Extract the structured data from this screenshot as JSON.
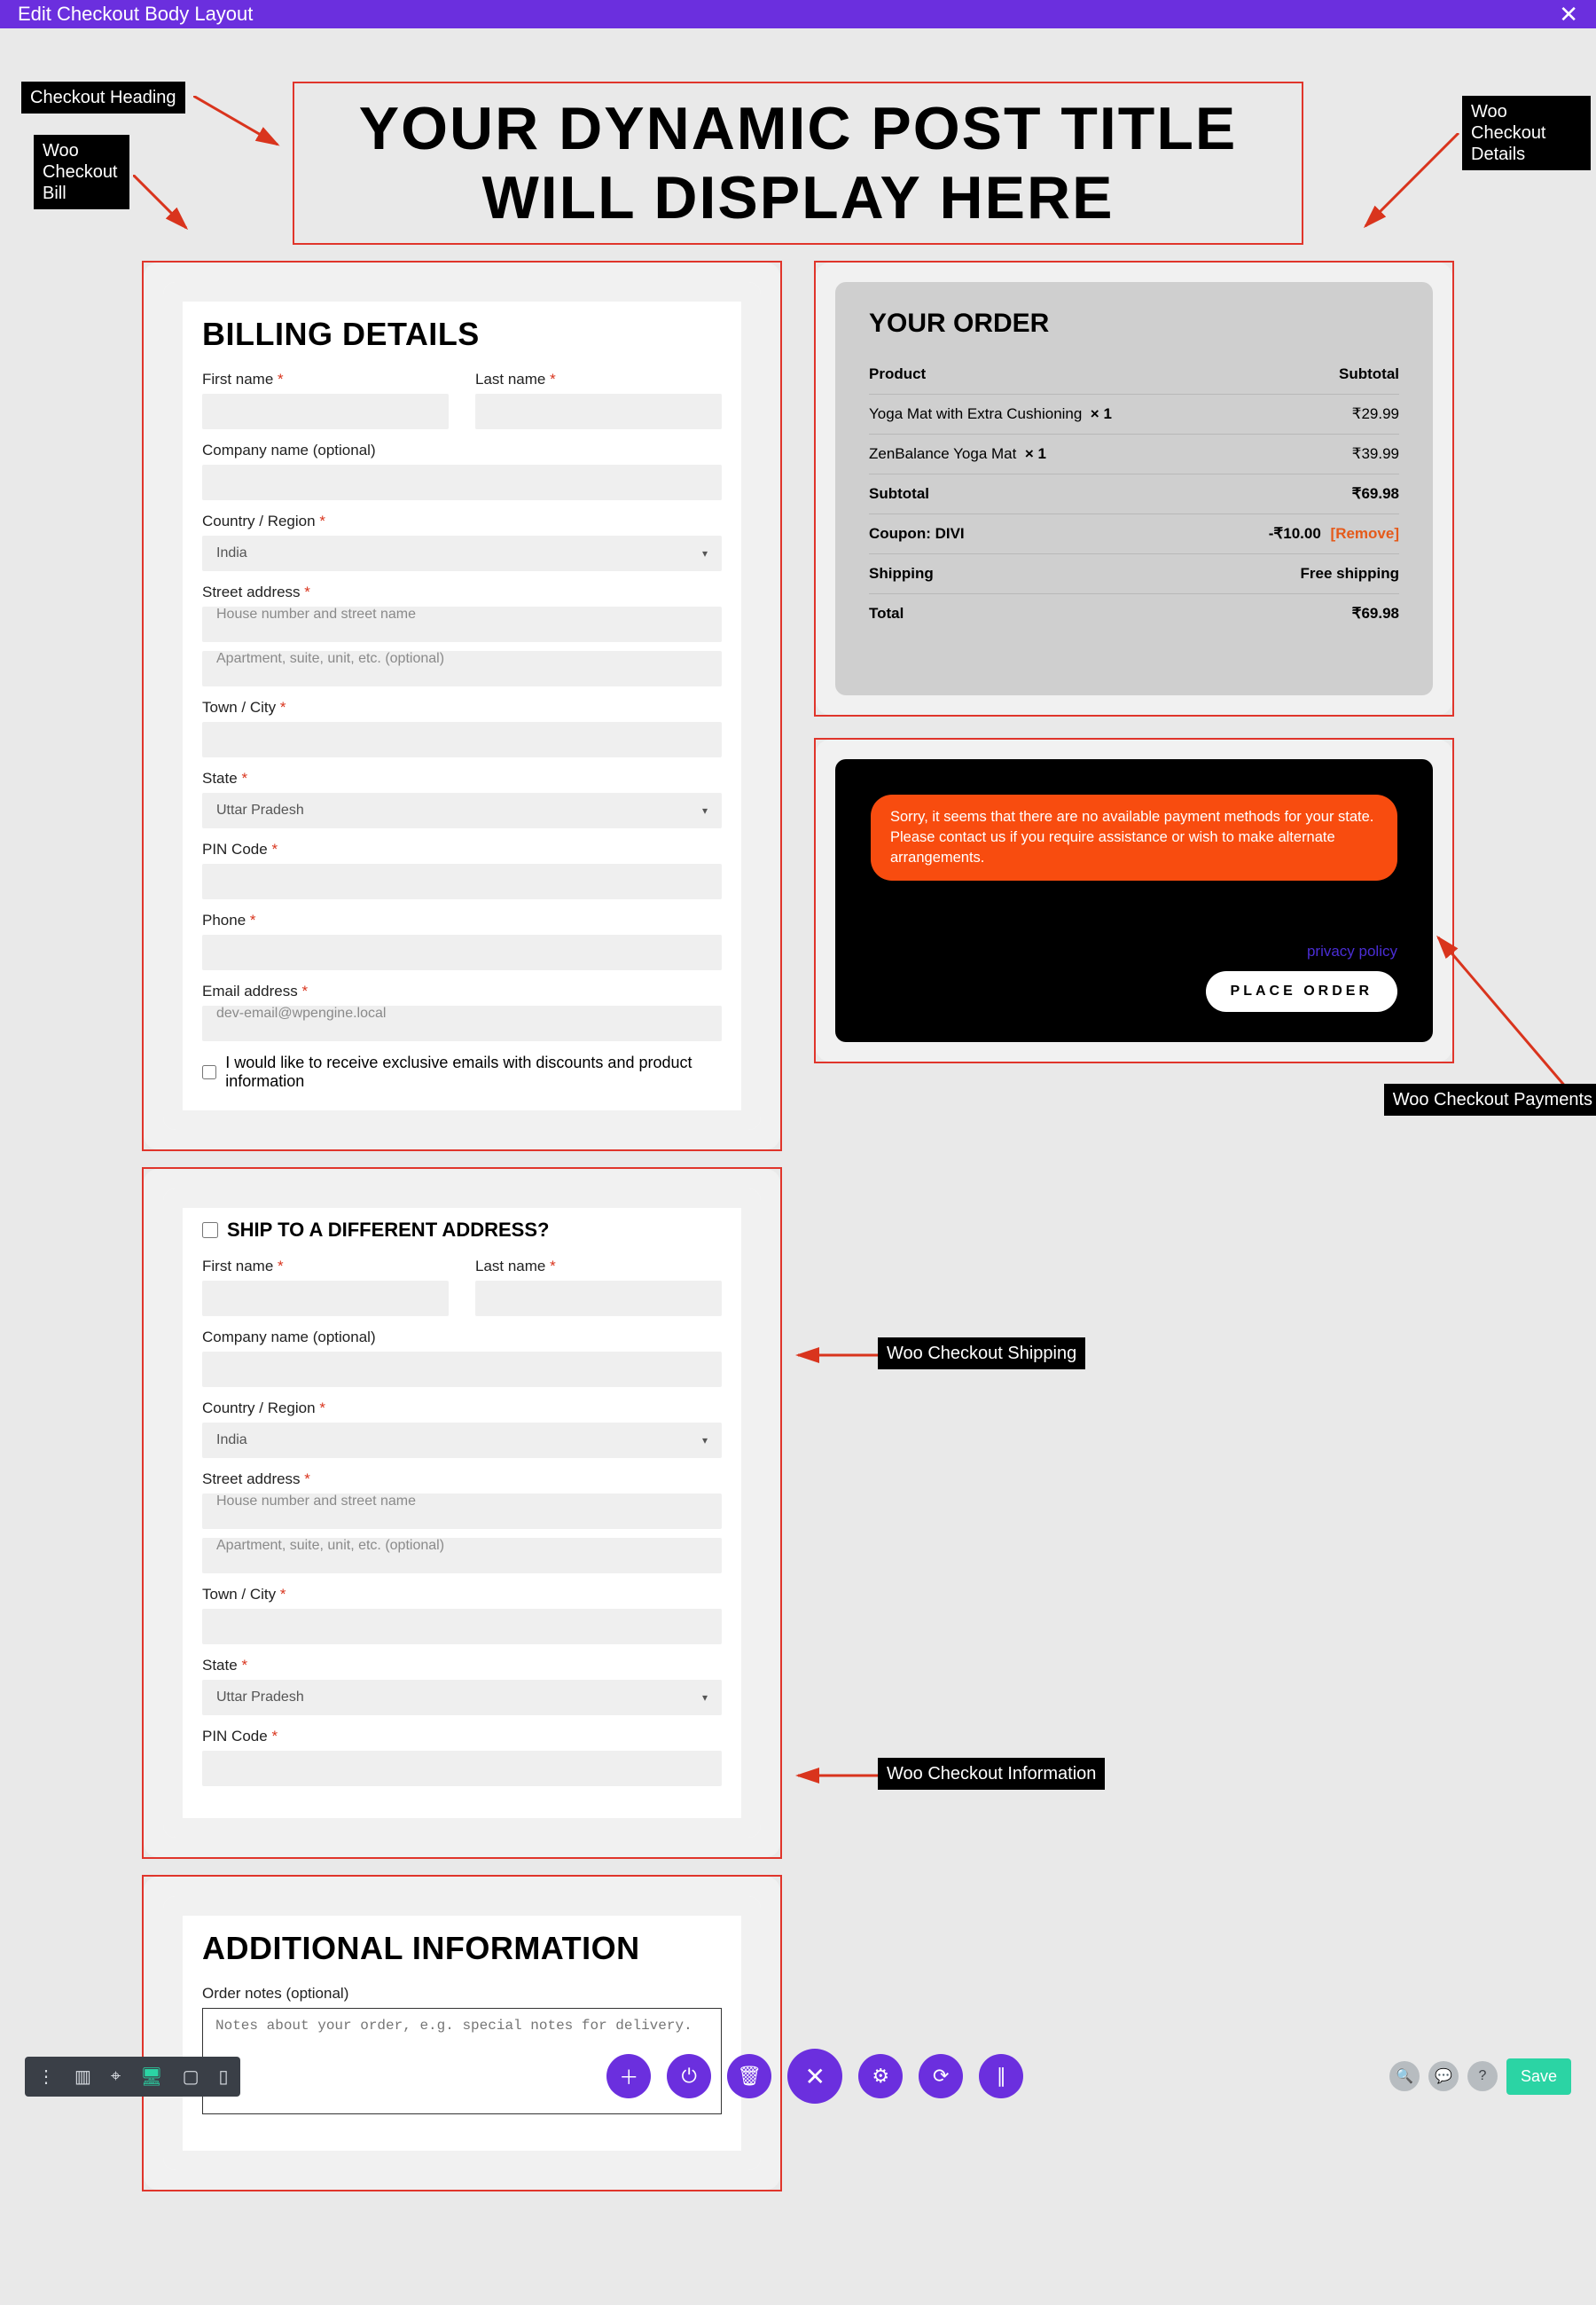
{
  "titlebar": {
    "title": "Edit Checkout Body Layout",
    "close": "✕"
  },
  "annotations": {
    "heading": "Checkout Heading",
    "bill": "Woo Checkout Bill",
    "details": "Woo Checkout Details",
    "shipping": "Woo Checkout Shipping",
    "info": "Woo Checkout Information",
    "payments": "Woo Checkout Payments"
  },
  "heading": "Your Dynamic Post Title Will Display Here",
  "billing": {
    "title": "Billing Details",
    "labels": {
      "first_name": "First name",
      "last_name": "Last name",
      "company": "Company name (optional)",
      "country": "Country / Region",
      "street": "Street address",
      "street_ph1": "House number and street name",
      "street_ph2": "Apartment, suite, unit, etc. (optional)",
      "city": "Town / City",
      "state": "State",
      "pin": "PIN Code",
      "phone": "Phone",
      "email": "Email address",
      "email_ph": "dev-email@wpengine.local",
      "optin": "I would like to receive exclusive emails with discounts and product information"
    },
    "values": {
      "country": "India",
      "state": "Uttar Pradesh"
    }
  },
  "shipping": {
    "title": "Ship to a different address?",
    "labels": {
      "first_name": "First name",
      "last_name": "Last name",
      "company": "Company name (optional)",
      "country": "Country / Region",
      "street": "Street address",
      "street_ph1": "House number and street name",
      "street_ph2": "Apartment, suite, unit, etc. (optional)",
      "city": "Town / City",
      "state": "State",
      "pin": "PIN Code"
    },
    "values": {
      "country": "India",
      "state": "Uttar Pradesh"
    }
  },
  "info": {
    "title": "Additional Information",
    "notes_label": "Order notes (optional)",
    "notes_ph": "Notes about your order, e.g. special notes for delivery."
  },
  "order": {
    "title": "Your order",
    "head_product": "Product",
    "head_subtotal": "Subtotal",
    "items": [
      {
        "name": "Yoga Mat with Extra Cushioning",
        "qty": "× 1",
        "price": "₹29.99"
      },
      {
        "name": "ZenBalance Yoga Mat",
        "qty": "× 1",
        "price": "₹39.99"
      }
    ],
    "subtotal_label": "Subtotal",
    "subtotal": "₹69.98",
    "coupon_label": "Coupon: DIVI",
    "coupon_value": "-₹10.00",
    "coupon_remove": "[Remove]",
    "shipping_label": "Shipping",
    "shipping_value": "Free shipping",
    "total_label": "Total",
    "total": "₹69.98"
  },
  "payment": {
    "notice": "Sorry, it seems that there are no available payment methods for your state. Please contact us if you require assistance or wish to make alternate arrangements.",
    "policy": "privacy policy",
    "place_order": "PLACE ORDER"
  },
  "bottombar": {
    "save": "Save"
  }
}
